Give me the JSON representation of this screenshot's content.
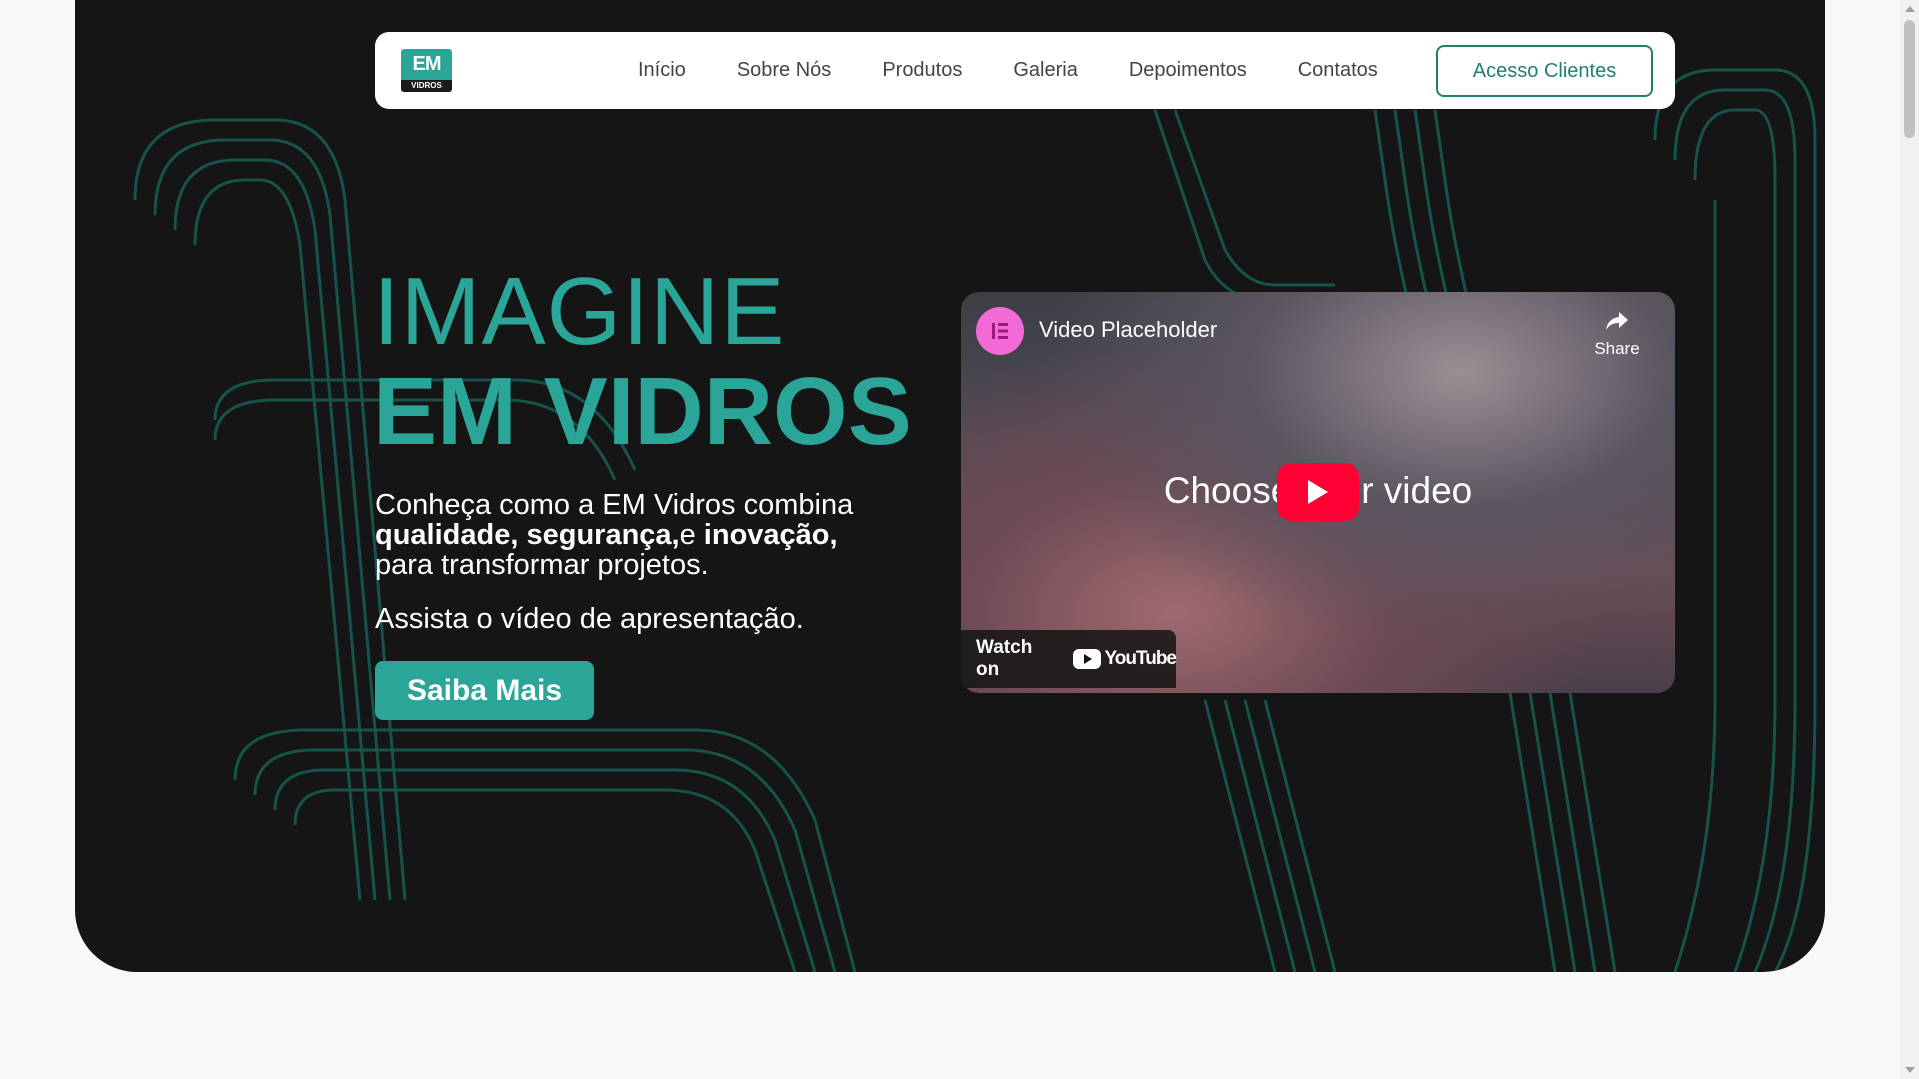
{
  "nav": {
    "logo_mark": "EM",
    "logo_sub": "VIDROS",
    "links": [
      "Início",
      "Sobre Nós",
      "Produtos",
      "Galeria",
      "Depoimentos",
      "Contatos"
    ],
    "client_button": "Acesso Clientes"
  },
  "hero": {
    "headline_line1": "IMAGINE",
    "headline_line2": "EM VIDROS",
    "intro_start": "Conheça como a EM Vidros combina",
    "intro_b1": "qualidade, segurança,",
    "intro_mid": "e ",
    "intro_b2": "inovação,",
    "intro_end": "para transformar projetos.",
    "watch_text": "Assista o vídeo de apresentação.",
    "cta_label": "Saiba Mais"
  },
  "video": {
    "title": "Video Placeholder",
    "share_label": "Share",
    "center_text": "Choose your video",
    "watch_on": "Watch on",
    "youtube_word": "YouTube"
  },
  "colors": {
    "accent": "#2aa597",
    "hero_bg": "#151515",
    "page_bg": "#f8f8f8",
    "play_red": "#ff0033",
    "channel_pink": "#f36ad6"
  }
}
